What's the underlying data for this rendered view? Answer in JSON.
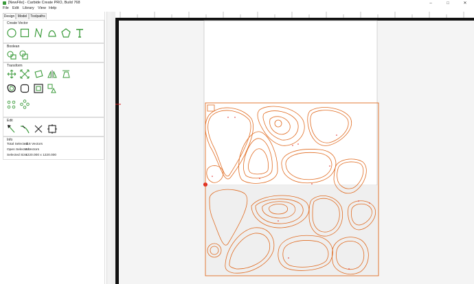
{
  "window": {
    "title": "[NewFile] - Carbide Create PRO, Build 768",
    "min_icon": "minimize-icon",
    "max_icon": "maximize-icon",
    "close_icon": "close-icon"
  },
  "menu": {
    "items": [
      "File",
      "Edit",
      "Library",
      "View",
      "Help"
    ]
  },
  "tabs": [
    "Design",
    "Model",
    "Toolpaths"
  ],
  "sections": {
    "create_vector": "Create Vector",
    "boolean": "Boolean",
    "transform": "Transform",
    "edit": "Edit",
    "info": "Info"
  },
  "info": {
    "total_selected_label": "Total Selected:",
    "total_selected_value": "116 Vectors",
    "open_selected_label": "Open Selected:",
    "open_selected_value": "0 Vectors",
    "selected_size_label": "Selected Size:",
    "selected_size_value": "1220.000 x 1220.000"
  },
  "colors": {
    "accent_green": "#3a9a3a",
    "vector_orange": "#e06a1f",
    "handle_red": "#e02020"
  },
  "icons": {
    "create_vector": [
      "circle-icon",
      "rectangle-icon",
      "polyline-icon",
      "curve-icon",
      "polygon-icon",
      "text-icon"
    ],
    "boolean": [
      "union-icon",
      "join-icon"
    ],
    "transform_row1": [
      "move-icon",
      "scale-icon",
      "rotate-icon",
      "mirror-icon",
      "align-icon"
    ],
    "transform_row2": [
      "offset-icon",
      "fillet-icon",
      "inset-icon",
      "nest-icon"
    ],
    "transform_row3": [
      "array-icon",
      "circular-array-icon"
    ],
    "edit": [
      "node-edit-icon",
      "trim-icon",
      "cut-icon",
      "bounding-icon"
    ]
  }
}
